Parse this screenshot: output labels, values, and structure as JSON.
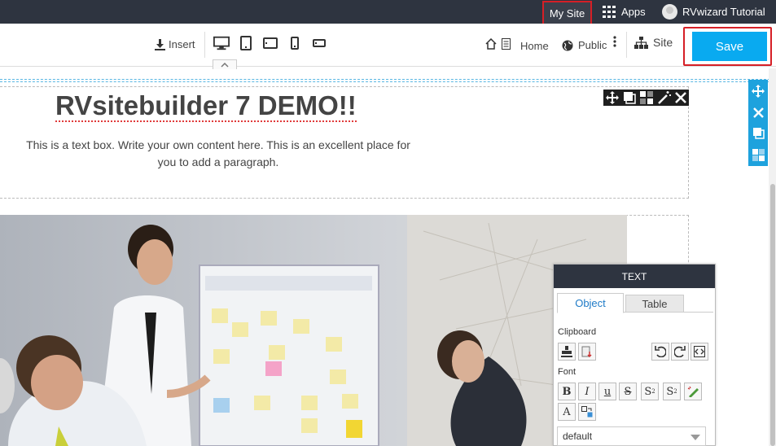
{
  "topbar": {
    "my_site": "My Site",
    "apps": "Apps",
    "user": "RVwizard Tutorial"
  },
  "toolbar": {
    "insert": "Insert",
    "home": "Home",
    "public": "Public",
    "site": "Site",
    "save": "Save"
  },
  "devices": [
    "desktop-icon",
    "tablet-portrait-icon",
    "tablet-landscape-icon",
    "mobile-portrait-icon",
    "mobile-landscape-icon"
  ],
  "content": {
    "headline": "RVsitebuilder 7 DEMO!!",
    "paragraph": "This is a text box. Write your own content here. This is an excellent place for you to add a paragraph."
  },
  "panel": {
    "title": "TEXT",
    "tabs": [
      "Object",
      "Table"
    ],
    "clipboard": "Clipboard",
    "font": "Font",
    "font_select": "default"
  },
  "colors": {
    "accent": "#09aaf0",
    "highlight": "#d61f26",
    "topbar": "#2e3440"
  }
}
